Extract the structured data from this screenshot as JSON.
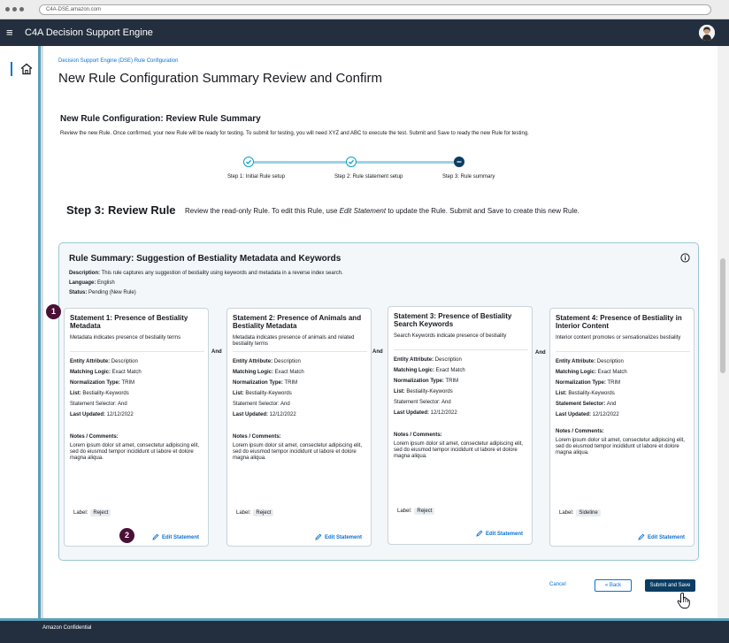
{
  "browser": {
    "url": "C4A-DSE.amazon.com"
  },
  "header": {
    "app_title": "C4A Decision Support Engine"
  },
  "page": {
    "breadcrumb": "Decision Support Engine (DSE) Rule Configuration",
    "title": "New Rule Configuration Summary Review and Confirm",
    "section_title": "New Rule Configuration: Review Rule Summary",
    "section_desc": "Review the new Rule. Once confirmed, your new Rule will be ready for testing.  To submit for testing, you will need XYZ and ABC to execute the test.   Submit and Save to ready the new Rule for testing."
  },
  "stepper": {
    "steps": [
      {
        "label": "Step 1: Initial Rule setup",
        "state": "complete"
      },
      {
        "label": "Step 2: Rule statement setup",
        "state": "complete"
      },
      {
        "label": "Step 3: Rule summary",
        "state": "current"
      }
    ]
  },
  "step3": {
    "title": "Step 3:  Review Rule",
    "desc_pre": "Review the read-only Rule. To edit this Rule, use ",
    "desc_em": "Edit Statement",
    "desc_post": " to update the Rule.  Submit and Save to create this new Rule."
  },
  "summary": {
    "title": "Rule Summary:  Suggestion of Bestiality Metadata and Keywords",
    "description_label": "Description:",
    "description": " This rule captures any suggestion of bestiality using keywords  and metadata in a reverse index search.",
    "language_label": "Language:",
    "language": " English",
    "status_label": "Status:",
    "status": " Pending (New Rule)"
  },
  "connector": "And",
  "labels": {
    "entity_attribute": "Entity Attribute:",
    "matching_logic": "Matching Logic:",
    "normalization_type": "Normalization Type:",
    "list": "List:",
    "statement_selector": "Statement Selector:",
    "last_updated": "Last Updated:",
    "notes": "Notes / Comments:",
    "label": "Label:",
    "edit": "Edit Statement"
  },
  "statements": [
    {
      "title": "Statement 1: Presence of Bestiality Metadata",
      "subtitle": "Metadata indicates presence of bestiality terms",
      "entity_attribute": " Description",
      "matching_logic": " Exact Match",
      "normalization_type": " TRIM",
      "list": " Bestiality-Keywords",
      "statement_selector": " And",
      "last_updated": "  12/12/2022",
      "notes": "Lorem ipsum dolor sit amet, consectetur adipiscing elit, sed do eiusmod tempor incididunt ut labore et dolore magna aliqua.",
      "label": "Reject"
    },
    {
      "title": "Statement 2: Presence of Animals and Bestiality Metadata",
      "subtitle": "Metadata indicates presence of animals and related bestiality terms",
      "entity_attribute": " Description",
      "matching_logic": " Exact Match",
      "normalization_type": " TRIM",
      "list": " Bestiality-Keywords",
      "statement_selector": " And",
      "last_updated": "  12/12/2022",
      "notes": "Lorem ipsum dolor sit amet, consectetur adipiscing elit, sed do eiusmod tempor incididunt ut labore et dolore magna aliqua.",
      "label": "Reject"
    },
    {
      "title": "Statement 3: Presence of Bestiality Search Keywords",
      "subtitle": "Search Keywords indicate presence of bestiality",
      "entity_attribute": " Description",
      "matching_logic": " Exact Match",
      "normalization_type": " TRIM",
      "list": " Bestiality-Keywords",
      "statement_selector": " And",
      "last_updated": "  12/12/2022",
      "notes": "Lorem ipsum dolor sit amet, consectetur adipiscing elit, sed do eiusmod tempor incididunt ut labore et dolore magna aliqua.",
      "label": "Reject"
    },
    {
      "title": "Statement 4: Presence of Bestiality in Interior Content",
      "subtitle": "Interior content promotes or sensationalizes bestiality",
      "entity_attribute": " Description",
      "matching_logic": " Exact Match",
      "normalization_type": " TRIM",
      "list": " Bestiality-Keywords",
      "statement_selector": " And",
      "last_updated": "  12/12/2022",
      "notes": "Lorem ipsum dolor sit amet, consectetur adipiscing elit, sed do eiusmod tempor incididunt ut labore et dolore magna aliqua.",
      "label": "Sideline"
    }
  ],
  "badges": [
    "1",
    "2"
  ],
  "actions": {
    "cancel": "Cancel",
    "back": "Back",
    "submit": "Submit and Save"
  },
  "footer": {
    "text": "Amazon Confidential"
  },
  "icons": [
    "menu-icon",
    "avatar-icon",
    "home-icon",
    "check-icon",
    "info-icon",
    "pencil-icon",
    "chevron-left-icon",
    "hand-cursor-icon"
  ],
  "colors": {
    "header_bg": "#232f3e",
    "accent": "#0972d3",
    "primary_button": "#0b3d63",
    "badge": "#4a1035",
    "step_line": "#9ad3e3"
  }
}
